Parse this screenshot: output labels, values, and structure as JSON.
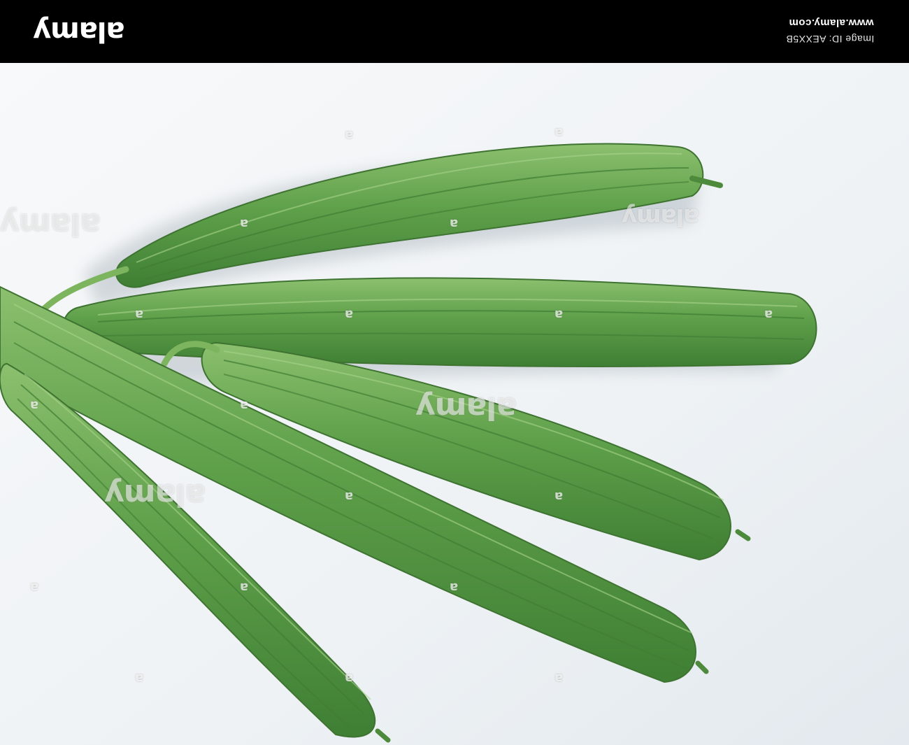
{
  "header": {
    "logo": "alamy",
    "site_url": "www.alamy.com",
    "image_id": "Image ID: AEXX5B"
  },
  "photo": {
    "subject": "five ridged luffa gourds",
    "background_color": "#f4f6f8",
    "gourd_color": "#5fa04a"
  },
  "watermark": {
    "text": "alamy",
    "mark": "a"
  }
}
